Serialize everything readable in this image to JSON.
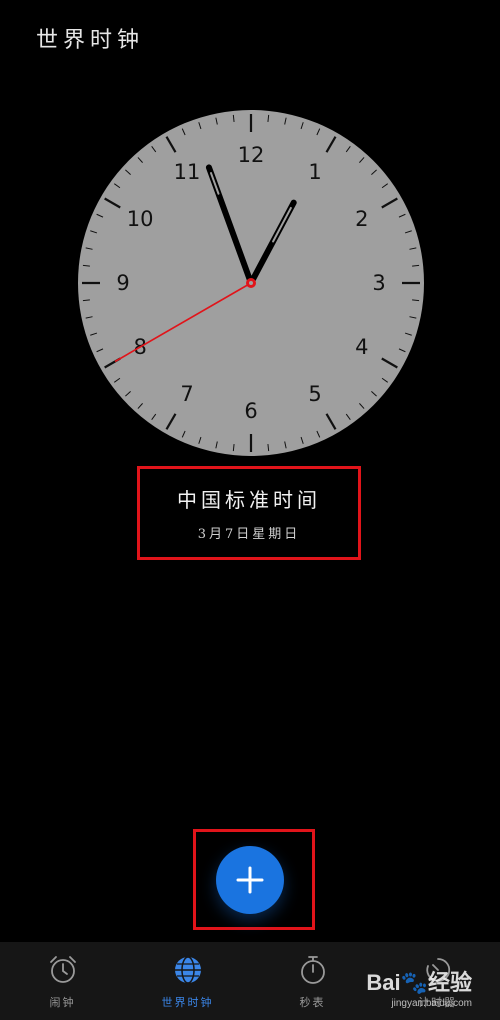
{
  "header": {
    "title": "世界时钟"
  },
  "clock": {
    "numerals": [
      "12",
      "1",
      "2",
      "3",
      "4",
      "5",
      "6",
      "7",
      "8",
      "9",
      "10",
      "11"
    ],
    "time": {
      "hour": 12,
      "minute": 56,
      "second": 40
    },
    "colors": {
      "face": "#9f9f9f",
      "hands": "#000000",
      "second_hand": "#e1141a",
      "marks": "#111111"
    }
  },
  "timezone": {
    "name": "中国标准时间",
    "date": "3月7日星期日"
  },
  "fab": {
    "icon": "plus-icon",
    "color": "#1a74e0"
  },
  "tabs": [
    {
      "label": "闹钟",
      "icon": "alarm-clock-icon",
      "active": false
    },
    {
      "label": "世界时钟",
      "icon": "globe-icon",
      "active": true
    },
    {
      "label": "秒表",
      "icon": "stopwatch-icon",
      "active": false
    },
    {
      "label": "计时器",
      "icon": "timer-icon",
      "active": false
    }
  ],
  "watermark": {
    "brand": "Bai",
    "suffix": "经验",
    "url": "jingyan.baidu.com"
  }
}
